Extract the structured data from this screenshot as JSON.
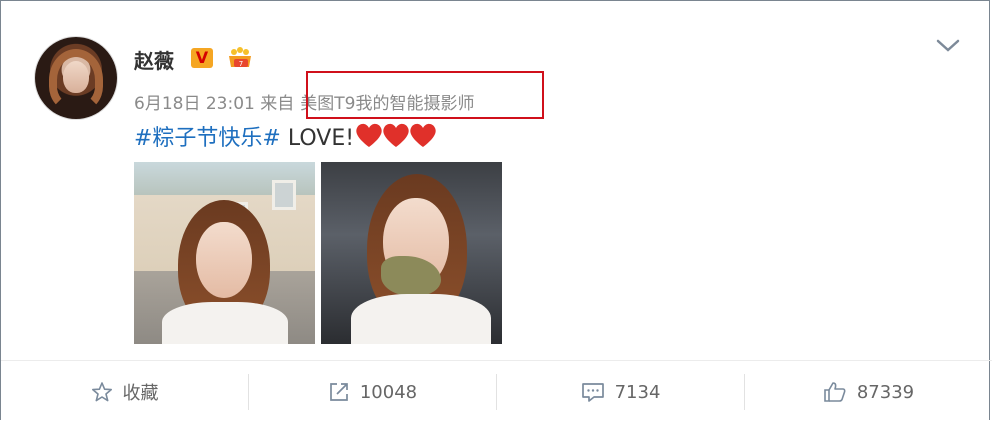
{
  "post": {
    "username": "赵薇",
    "verified_badge": "V",
    "vip_icon": "vip-crown-icon",
    "date": "6月18日 23:01",
    "from_label": "来自",
    "source": "美图T9我的智能摄影师",
    "hashtag": "#粽子节快乐#",
    "text": " LOVE!",
    "hearts_count": 3
  },
  "actions": {
    "favorite_label": "收藏",
    "repost_count": "10048",
    "comment_count": "7134",
    "like_count": "87339"
  },
  "colors": {
    "hashtag": "#1e6fbf",
    "highlight_box": "#d0101b",
    "heart": "#e0302a",
    "verified_badge_bg": "#f5a623"
  }
}
